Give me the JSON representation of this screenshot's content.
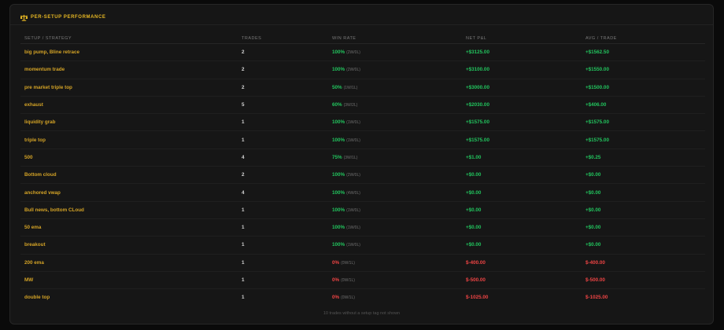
{
  "panel": {
    "icon": "scale-icon",
    "title": "PER-SETUP PERFORMANCE",
    "accent_color": "#e8b823"
  },
  "table": {
    "columns": [
      "SETUP / STRATEGY",
      "TRADES",
      "WIN RATE",
      "NET P&L",
      "AVG / TRADE"
    ],
    "rows": [
      {
        "setup": "big pump, Bline retrace",
        "trades": "2",
        "win_rate": "100%",
        "wl": "(2W/0L)",
        "net_pl": "+$3125.00",
        "avg": "+$1562.50",
        "positive": true
      },
      {
        "setup": "momentum trade",
        "trades": "2",
        "win_rate": "100%",
        "wl": "(2W/0L)",
        "net_pl": "+$3100.00",
        "avg": "+$1550.00",
        "positive": true
      },
      {
        "setup": "pre market triple top",
        "trades": "2",
        "win_rate": "50%",
        "wl": "(1W/1L)",
        "net_pl": "+$3000.00",
        "avg": "+$1500.00",
        "positive": true
      },
      {
        "setup": "exhaust",
        "trades": "5",
        "win_rate": "60%",
        "wl": "(3W/2L)",
        "net_pl": "+$2030.00",
        "avg": "+$406.00",
        "positive": true
      },
      {
        "setup": "liquidity grab",
        "trades": "1",
        "win_rate": "100%",
        "wl": "(1W/0L)",
        "net_pl": "+$1575.00",
        "avg": "+$1575.00",
        "positive": true
      },
      {
        "setup": "triple top",
        "trades": "1",
        "win_rate": "100%",
        "wl": "(1W/0L)",
        "net_pl": "+$1575.00",
        "avg": "+$1575.00",
        "positive": true
      },
      {
        "setup": "500",
        "trades": "4",
        "win_rate": "75%",
        "wl": "(3W/1L)",
        "net_pl": "+$1.00",
        "avg": "+$0.25",
        "positive": true
      },
      {
        "setup": "Bottom cloud",
        "trades": "2",
        "win_rate": "100%",
        "wl": "(2W/0L)",
        "net_pl": "+$0.00",
        "avg": "+$0.00",
        "positive": true
      },
      {
        "setup": "anchored vwap",
        "trades": "4",
        "win_rate": "100%",
        "wl": "(4W/0L)",
        "net_pl": "+$0.00",
        "avg": "+$0.00",
        "positive": true
      },
      {
        "setup": "Bull news, bottom CLoud",
        "trades": "1",
        "win_rate": "100%",
        "wl": "(1W/0L)",
        "net_pl": "+$0.00",
        "avg": "+$0.00",
        "positive": true
      },
      {
        "setup": "50 ema",
        "trades": "1",
        "win_rate": "100%",
        "wl": "(1W/0L)",
        "net_pl": "+$0.00",
        "avg": "+$0.00",
        "positive": true
      },
      {
        "setup": "breakout",
        "trades": "1",
        "win_rate": "100%",
        "wl": "(1W/0L)",
        "net_pl": "+$0.00",
        "avg": "+$0.00",
        "positive": true
      },
      {
        "setup": "200 ema",
        "trades": "1",
        "win_rate": "0%",
        "wl": "(0W/1L)",
        "net_pl": "$-400.00",
        "avg": "$-400.00",
        "positive": false
      },
      {
        "setup": "MW",
        "trades": "1",
        "win_rate": "0%",
        "wl": "(0W/1L)",
        "net_pl": "$-500.00",
        "avg": "$-500.00",
        "positive": false
      },
      {
        "setup": "double top",
        "trades": "1",
        "win_rate": "0%",
        "wl": "(0W/1L)",
        "net_pl": "$-1025.00",
        "avg": "$-1025.00",
        "positive": false
      }
    ]
  },
  "footnote": "10 trades without a setup tag not shown",
  "colors": {
    "background": "#0a0a0a",
    "panel": "#161616",
    "setup_text": "#d4a326",
    "positive": "#22c55e",
    "negative": "#ef4444",
    "muted": "#7a7a7a"
  }
}
